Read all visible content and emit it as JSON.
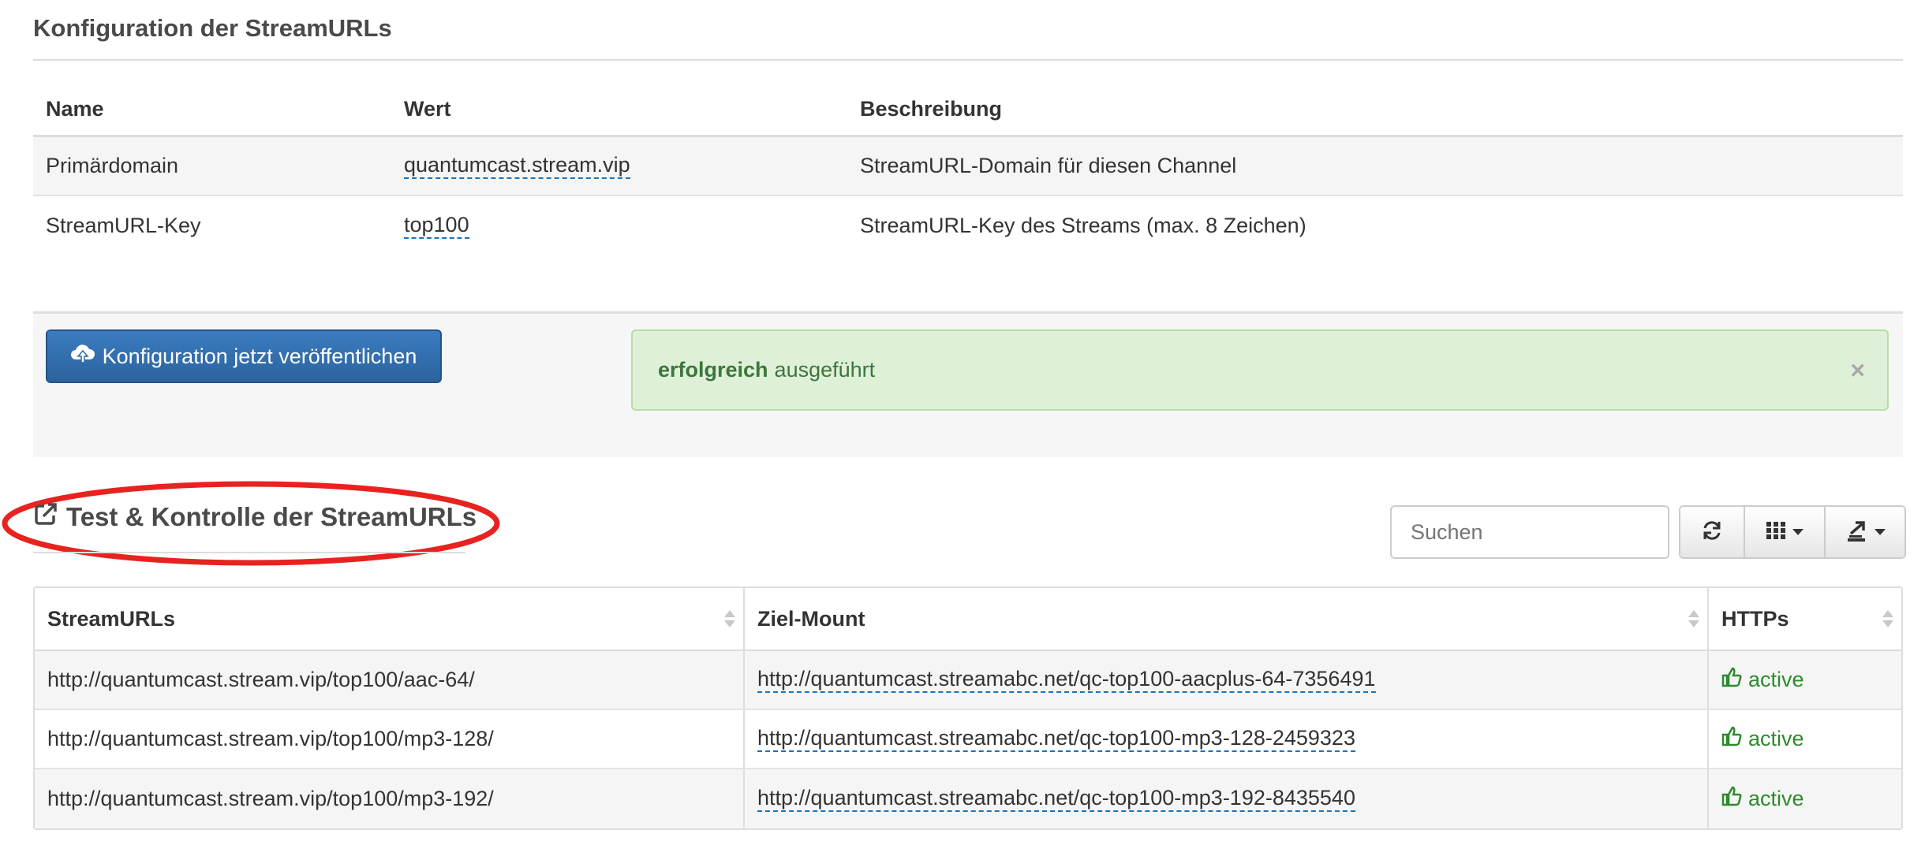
{
  "config_section": {
    "title": "Konfiguration der StreamURLs",
    "headers": {
      "name": "Name",
      "value": "Wert",
      "description": "Beschreibung"
    },
    "rows": [
      {
        "name": "Primärdomain",
        "value": "quantumcast.stream.vip",
        "description": "StreamURL-Domain für diesen Channel"
      },
      {
        "name": "StreamURL-Key",
        "value": "top100",
        "description": "StreamURL-Key des Streams (max. 8 Zeichen)"
      }
    ]
  },
  "actions": {
    "publish_label": "Konfiguration jetzt veröffentlichen",
    "alert_strong": "erfolgreich",
    "alert_text": "ausgeführt",
    "alert_close": "×"
  },
  "test_section": {
    "title": "Test & Kontrolle der StreamURLs",
    "search_placeholder": "Suchen",
    "headers": {
      "urls": "StreamURLs",
      "mount": "Ziel-Mount",
      "https": "HTTPs"
    },
    "rows": [
      {
        "url": "http://quantumcast.stream.vip/top100/aac-64/",
        "mount": "http://quantumcast.streamabc.net/qc-top100-aacplus-64-7356491",
        "https": "active"
      },
      {
        "url": "http://quantumcast.stream.vip/top100/mp3-128/",
        "mount": "http://quantumcast.streamabc.net/qc-top100-mp3-128-2459323",
        "https": "active"
      },
      {
        "url": "http://quantumcast.stream.vip/top100/mp3-192/",
        "mount": "http://quantumcast.streamabc.net/qc-top100-mp3-192-8435540",
        "https": "active"
      }
    ]
  },
  "colors": {
    "primary_button": "#2c639e",
    "success_bg": "#dff0d8",
    "success_text": "#3c763d",
    "active_green": "#2d8a2d",
    "highlight_ellipse": "#e8231f"
  },
  "icons": [
    "cloud-upload-icon",
    "external-link-icon",
    "refresh-icon",
    "grid-columns-icon",
    "export-icon",
    "thumbs-up-icon",
    "sort-icon",
    "close-icon"
  ]
}
